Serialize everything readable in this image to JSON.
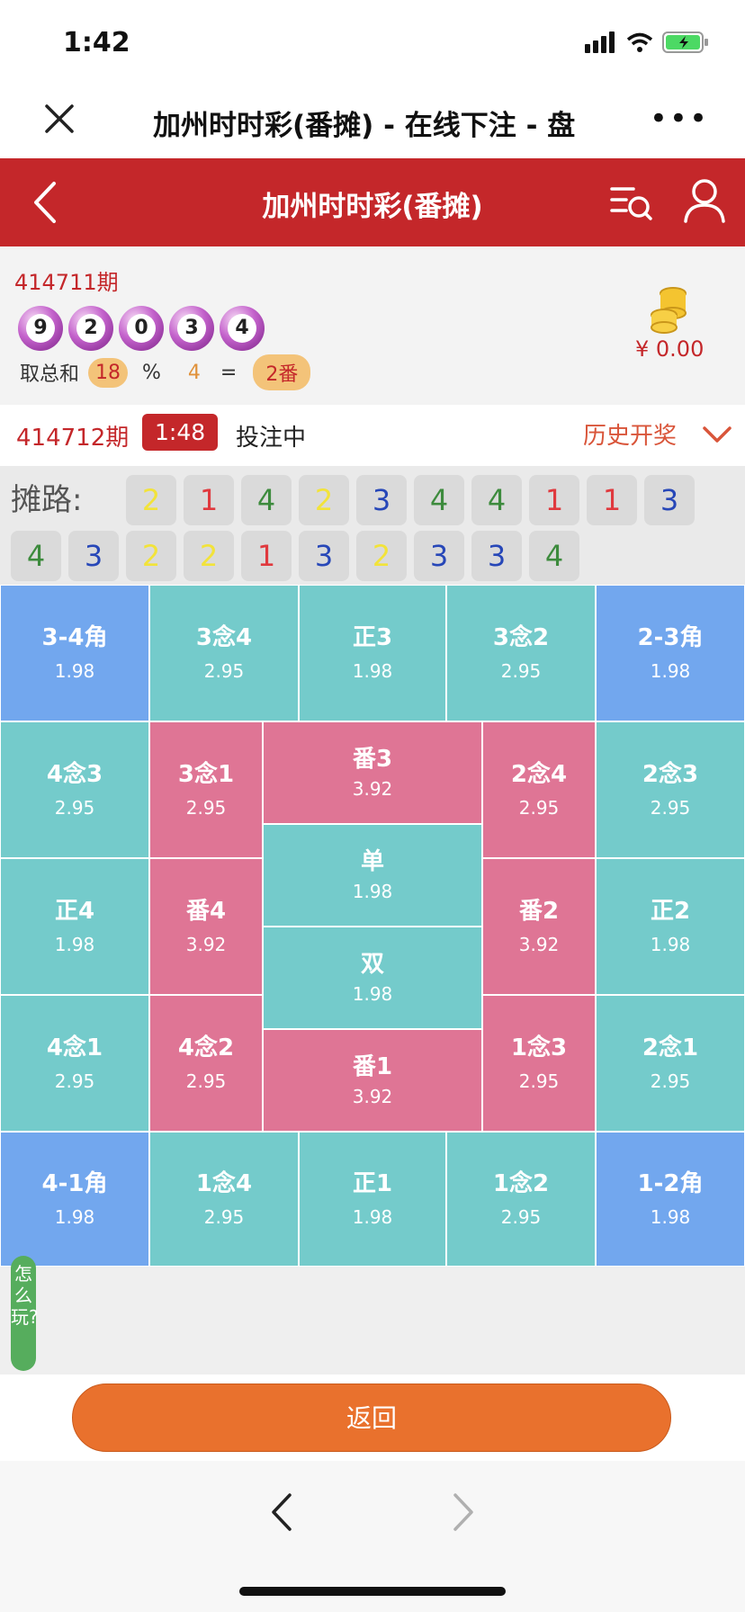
{
  "status_bar": {
    "time": "1:42"
  },
  "wechat_bar": {
    "title": "加州时时彩(番摊) - 在线下注 - 盘",
    "more": "•••",
    "close_icon": "close-icon"
  },
  "header": {
    "title": "加州时时彩(番摊)",
    "back_icon": "back-icon",
    "list_icon": "search-list-icon",
    "user_icon": "user-icon",
    "bg_color": "#c4272a"
  },
  "last_draw": {
    "issue": "414711期",
    "balls": [
      "9",
      "2",
      "0",
      "3",
      "4"
    ],
    "formula": {
      "label": "取总和",
      "sum": "18",
      "mod_sign": "%",
      "mod": "4",
      "eq": "=",
      "result": "2番"
    }
  },
  "wallet": {
    "icon": "coins-icon",
    "balance": "¥ 0.00"
  },
  "current": {
    "issue": "414712期",
    "countdown": "1:48",
    "status": "投注中",
    "history": "历史开奖"
  },
  "road": {
    "label": "摊路:",
    "row1": [
      "2",
      "1",
      "4",
      "2",
      "3",
      "4",
      "4",
      "1",
      "1",
      "3"
    ],
    "row2": [
      "4",
      "3",
      "2",
      "2",
      "1",
      "3",
      "2",
      "3",
      "3",
      "4"
    ],
    "colors": {
      "1": "#e0393e",
      "2": "#f2e33a",
      "3": "#2747b8",
      "4": "#3d8b3d"
    }
  },
  "bets": {
    "c34jiao": {
      "name": "3-4角",
      "odds": "1.98"
    },
    "c3nian4": {
      "name": "3念4",
      "odds": "2.95"
    },
    "zheng3": {
      "name": "正3",
      "odds": "1.98"
    },
    "c3nian2": {
      "name": "3念2",
      "odds": "2.95"
    },
    "c23jiao": {
      "name": "2-3角",
      "odds": "1.98"
    },
    "c4nian3": {
      "name": "4念3",
      "odds": "2.95"
    },
    "c3nian1": {
      "name": "3念1",
      "odds": "2.95"
    },
    "fan3": {
      "name": "番3",
      "odds": "3.92"
    },
    "c2nian4": {
      "name": "2念4",
      "odds": "2.95"
    },
    "c2nian3": {
      "name": "2念3",
      "odds": "2.95"
    },
    "dan": {
      "name": "单",
      "odds": "1.98"
    },
    "zheng4": {
      "name": "正4",
      "odds": "1.98"
    },
    "fan4": {
      "name": "番4",
      "odds": "3.92"
    },
    "fan2": {
      "name": "番2",
      "odds": "3.92"
    },
    "zheng2": {
      "name": "正2",
      "odds": "1.98"
    },
    "shuang": {
      "name": "双",
      "odds": "1.98"
    },
    "c4nian1": {
      "name": "4念1",
      "odds": "2.95"
    },
    "c4nian2": {
      "name": "4念2",
      "odds": "2.95"
    },
    "fan1": {
      "name": "番1",
      "odds": "3.92"
    },
    "c1nian3": {
      "name": "1念3",
      "odds": "2.95"
    },
    "c2nian1": {
      "name": "2念1",
      "odds": "2.95"
    },
    "c41jiao": {
      "name": "4-1角",
      "odds": "1.98"
    },
    "c1nian4": {
      "name": "1念4",
      "odds": "2.95"
    },
    "zheng1": {
      "name": "正1",
      "odds": "1.98"
    },
    "c1nian2": {
      "name": "1念2",
      "odds": "2.95"
    },
    "c12jiao": {
      "name": "1-2角",
      "odds": "1.98"
    }
  },
  "howto": "怎么玩?",
  "footer": {
    "return_label": "返回",
    "back_icon": "chevron-left-icon",
    "forward_icon": "chevron-right-icon"
  }
}
